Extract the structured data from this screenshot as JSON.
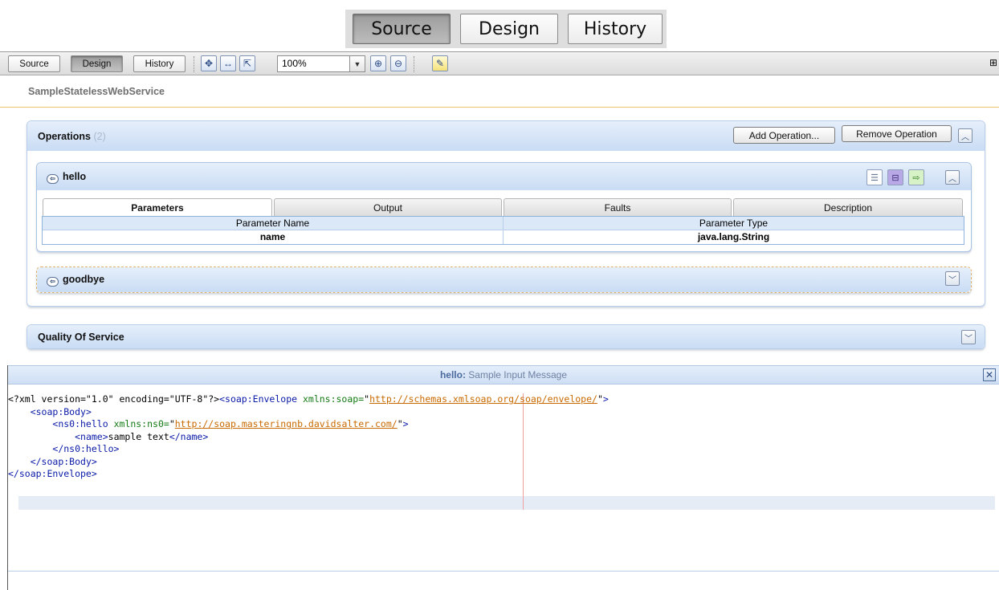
{
  "big_tabs": {
    "source": "Source",
    "design": "Design",
    "history": "History",
    "active": "Source"
  },
  "toolbar": {
    "source": "Source",
    "design": "Design",
    "history": "History",
    "zoom": "100%",
    "active": "Design"
  },
  "service": {
    "name": "SampleStatelessWebService"
  },
  "operations": {
    "title": "Operations",
    "count": "(2)",
    "add_label": "Add Operation...",
    "remove_label": "Remove Operation",
    "items": [
      {
        "name": "hello",
        "tabs": [
          "Parameters",
          "Output",
          "Faults",
          "Description"
        ],
        "active_tab": "Parameters",
        "table": {
          "columns": [
            "Parameter Name",
            "Parameter Type"
          ],
          "rows": [
            [
              "name",
              "java.lang.String"
            ]
          ]
        }
      },
      {
        "name": "goodbye"
      }
    ]
  },
  "qos": {
    "title": "Quality Of Service"
  },
  "message": {
    "op": "hello:",
    "title": " Sample Input Message",
    "lines": [
      {
        "indent": "",
        "parts": [
          [
            "pi",
            "<?xml"
          ],
          [
            "plain",
            " version=\"1.0\" encoding=\"UTF-8\"?>"
          ],
          [
            "tag",
            "<soap:Envelope"
          ],
          [
            "attr",
            " xmlns:soap="
          ],
          [
            "plain",
            "\""
          ],
          [
            "val",
            "http://schemas.xmlsoap.org/soap/envelope/"
          ],
          [
            "plain",
            "\""
          ],
          [
            "tag",
            ">"
          ]
        ]
      },
      {
        "indent": "    ",
        "parts": [
          [
            "tag",
            "<soap:Body>"
          ]
        ]
      },
      {
        "indent": "        ",
        "parts": [
          [
            "tag",
            "<ns0:hello"
          ],
          [
            "attr",
            " xmlns:ns0="
          ],
          [
            "plain",
            "\""
          ],
          [
            "val",
            "http://soap.masteringnb.davidsalter.com/"
          ],
          [
            "plain",
            "\""
          ],
          [
            "tag",
            ">"
          ]
        ]
      },
      {
        "indent": "            ",
        "parts": [
          [
            "tag",
            "<name>"
          ],
          [
            "plain",
            "sample text"
          ],
          [
            "tag",
            "</name>"
          ]
        ]
      },
      {
        "indent": "        ",
        "parts": [
          [
            "tag",
            "</ns0:hello>"
          ]
        ]
      },
      {
        "indent": "    ",
        "parts": [
          [
            "tag",
            "</soap:Body>"
          ]
        ]
      },
      {
        "indent": "",
        "parts": [
          [
            "tag",
            "</soap:Envelope>"
          ]
        ]
      }
    ]
  },
  "colors": {
    "accent": "#c9dcf4",
    "orange_rule": "#f1c068",
    "tag": "#0a1aa8",
    "attr": "#137a13",
    "link": "#c86a00"
  }
}
